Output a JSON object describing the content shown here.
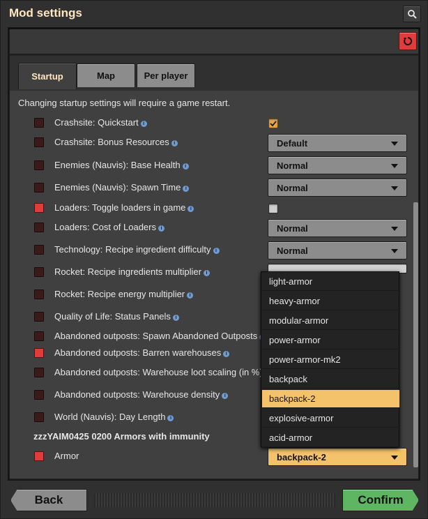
{
  "window": {
    "title": "Mod settings",
    "icons": {
      "search": "search-icon",
      "reset": "reset-icon"
    }
  },
  "tabs": [
    {
      "label": "Startup",
      "active": true
    },
    {
      "label": "Map",
      "active": false
    },
    {
      "label": "Per player",
      "active": false
    }
  ],
  "notice": "Changing startup settings will require a game restart.",
  "settings": [
    {
      "label": "Crashsite: Quickstart",
      "control": "checkbox",
      "checked": true,
      "icon_red": false
    },
    {
      "label": "Crashsite: Bonus Resources",
      "control": "dropdown",
      "value": "Default",
      "icon_red": false
    },
    {
      "label": "Enemies (Nauvis): Base Health",
      "control": "dropdown",
      "value": "Normal",
      "icon_red": false
    },
    {
      "label": "Enemies (Nauvis): Spawn Time",
      "control": "dropdown",
      "value": "Normal",
      "icon_red": false
    },
    {
      "label": "Loaders: Toggle loaders in game",
      "control": "checkbox",
      "checked": false,
      "icon_red": true
    },
    {
      "label": "Loaders: Cost of Loaders",
      "control": "dropdown",
      "value": "Normal",
      "icon_red": false
    },
    {
      "label": "Technology: Recipe ingredient difficulty",
      "control": "dropdown",
      "value": "Normal",
      "icon_red": false
    },
    {
      "label": "Rocket: Recipe ingredients multiplier",
      "control": "textfield",
      "icon_red": false
    },
    {
      "label": "Rocket: Recipe energy multiplier",
      "icon_red": false
    },
    {
      "label": "Quality of Life: Status Panels",
      "icon_red": false
    },
    {
      "label": "Abandoned outposts: Spawn Abandoned Outposts",
      "icon_red": false
    },
    {
      "label": "Abandoned outposts: Barren warehouses",
      "icon_red": true
    },
    {
      "label": "Abandoned outposts: Warehouse loot scaling (in %)",
      "icon_red": false
    },
    {
      "label": "Abandoned outposts: Warehouse density",
      "icon_red": false
    },
    {
      "label": "World (Nauvis): Day Length",
      "icon_red": false
    }
  ],
  "group_header": "zzzYAIM0425 0200 Armors with immunity",
  "armor": {
    "label": "Armor",
    "value": "backpack-2",
    "icon_red": true
  },
  "dropdown_options": [
    "light-armor",
    "heavy-armor",
    "modular-armor",
    "power-armor",
    "power-armor-mk2",
    "backpack",
    "backpack-2",
    "explosive-armor",
    "acid-armor"
  ],
  "highlighted_option": "backpack-2",
  "buttons": {
    "back": "Back",
    "confirm": "Confirm"
  },
  "colors": {
    "accent": "#f3c26b",
    "confirm": "#5eb663",
    "reset": "#e03c3c",
    "title": "#ffe6c0"
  }
}
